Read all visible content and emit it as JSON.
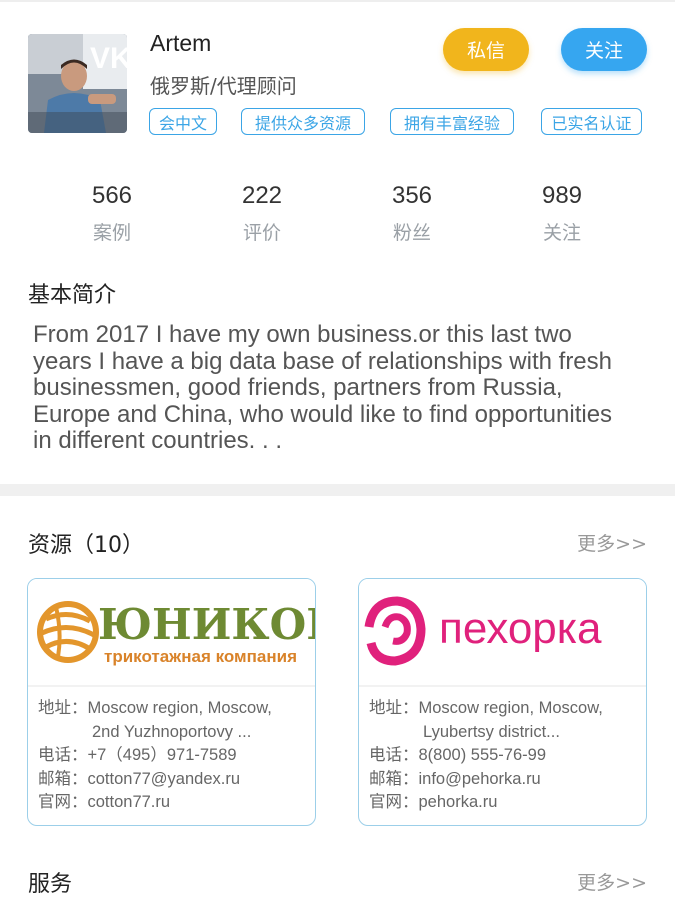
{
  "profile": {
    "name": "Artem",
    "role": "俄罗斯/代理顾问",
    "message_button": "私信",
    "follow_button": "关注",
    "tags": [
      "会中文",
      "提供众多资源",
      "拥有丰富经验",
      "已实名认证"
    ]
  },
  "stats": [
    {
      "value": "566",
      "label": "案例"
    },
    {
      "value": "222",
      "label": "评价"
    },
    {
      "value": "356",
      "label": "粉丝"
    },
    {
      "value": "989",
      "label": "关注"
    }
  ],
  "intro": {
    "title": "基本简介",
    "text": "From 2017 I have my own business.or this last two\nyears I have a big data base of relationships with fresh\n businessmen, good friends, partners from Russia,\nEurope and China, who would like to find opportunities\n in different countries. . ."
  },
  "resources": {
    "title": "资源（10）",
    "more": "更多>>",
    "cards": [
      {
        "logo_line1": "ЮНИКОР",
        "logo_line2": "трикотажная компания",
        "address_label": "地址：",
        "address_line1": "Moscow region, Moscow,",
        "address_line2": "2nd Yuzhnoportovy ...",
        "phone_label": "电话：",
        "phone": "+7（495）971-7589",
        "email_label": "邮箱：",
        "email": "cotton77@yandex.ru",
        "site_label": "官网：",
        "site": "cotton77.ru"
      },
      {
        "logo_line1": "пехорка",
        "address_label": "地址：",
        "address_line1": "Moscow region, Moscow,",
        "address_line2": "Lyubertsy district...",
        "phone_label": "电话：",
        "phone": "8(800) 555-76-99",
        "email_label": "邮箱：",
        "email": "info@pehorka.ru",
        "site_label": "官网：",
        "site": "pehorka.ru"
      }
    ]
  },
  "services": {
    "title": "服务",
    "more": "更多>>"
  },
  "colors": {
    "accent_blue": "#36a6f0",
    "accent_yellow": "#f1b51c",
    "tag_blue": "#3ba5e6"
  }
}
